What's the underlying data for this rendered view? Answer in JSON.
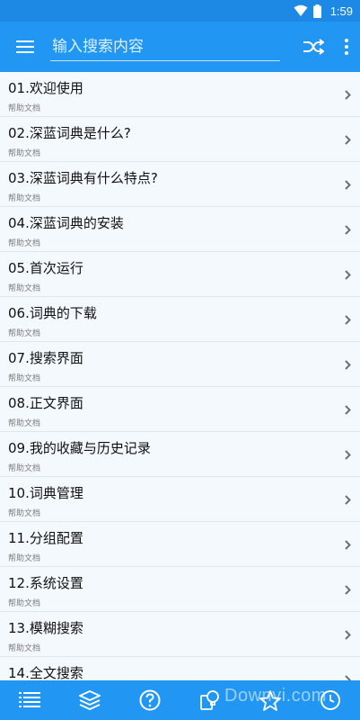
{
  "status_bar": {
    "time": "1:59"
  },
  "app_bar": {
    "search_placeholder": "输入搜索内容"
  },
  "list": {
    "items": [
      {
        "title": "01.欢迎使用",
        "subtitle": "帮助文档"
      },
      {
        "title": "02.深蓝词典是什么?",
        "subtitle": "帮助文档"
      },
      {
        "title": "03.深蓝词典有什么特点?",
        "subtitle": "帮助文档"
      },
      {
        "title": "04.深蓝词典的安装",
        "subtitle": "帮助文档"
      },
      {
        "title": "05.首次运行",
        "subtitle": "帮助文档"
      },
      {
        "title": "06.词典的下载",
        "subtitle": "帮助文档"
      },
      {
        "title": "07.搜索界面",
        "subtitle": "帮助文档"
      },
      {
        "title": "08.正文界面",
        "subtitle": "帮助文档"
      },
      {
        "title": "09.我的收藏与历史记录",
        "subtitle": "帮助文档"
      },
      {
        "title": "10.词典管理",
        "subtitle": "帮助文档"
      },
      {
        "title": "11.分组配置",
        "subtitle": "帮助文档"
      },
      {
        "title": "12.系统设置",
        "subtitle": "帮助文档"
      },
      {
        "title": "13.模糊搜索",
        "subtitle": "帮助文档"
      },
      {
        "title": "14.全文搜索",
        "subtitle": "帮助文档"
      }
    ]
  },
  "watermark": "Downyi.com",
  "colors": {
    "primary": "#2196f3",
    "status_bar": "#1e88e5",
    "list_background": "#f4f9fe",
    "divider": "#dfe6ec"
  },
  "icons": {
    "app_bar": [
      "menu-icon",
      "shuffle-icon",
      "more-vert-icon"
    ],
    "bottom_nav": [
      "list-icon",
      "layers-icon",
      "help-icon",
      "search-lightbulb-icon",
      "star-icon",
      "history-icon"
    ]
  }
}
